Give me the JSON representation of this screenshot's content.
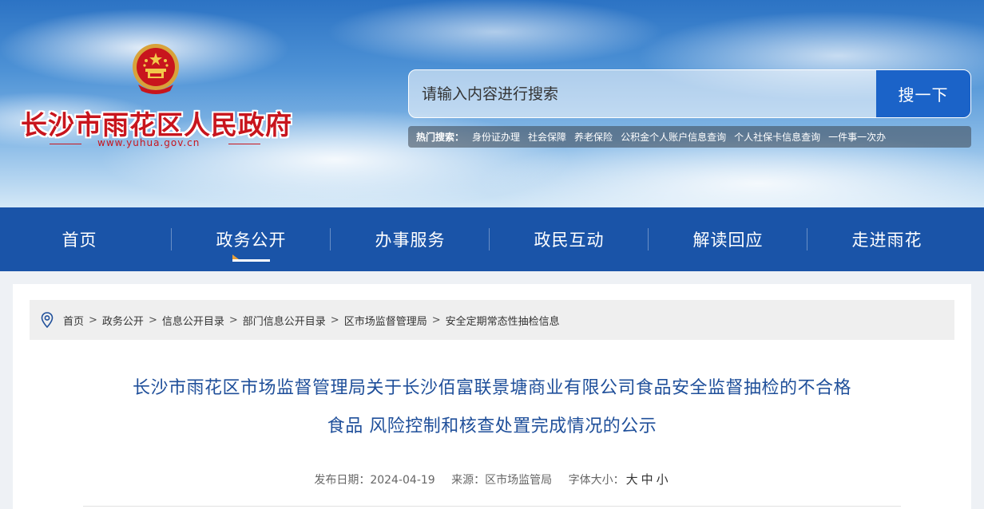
{
  "header": {
    "site_name": "长沙市雨花区人民政府",
    "site_domain": "www.yuhua.gov.cn",
    "emblem_icon": "national-emblem-icon",
    "brand_red": "#c8151d"
  },
  "search": {
    "placeholder": "请输入内容进行搜索",
    "button_label": "搜一下",
    "hot_label": "热门搜索：",
    "hot_links": [
      "身份证办理",
      "社会保障",
      "养老保险",
      "公积金个人账户信息查询",
      "个人社保卡信息查询",
      "一件事一次办"
    ]
  },
  "nav": {
    "bg_color": "#1a54a8",
    "items": [
      "首页",
      "政务公开",
      "办事服务",
      "政民互动",
      "解读回应",
      "走进雨花"
    ],
    "active_index": 1
  },
  "breadcrumb": {
    "icon": "location-pin-icon",
    "items": [
      "首页",
      "政务公开",
      "信息公开目录",
      "部门信息公开目录",
      "区市场监督管理局",
      "安全定期常态性抽检信息"
    ],
    "separator": ">"
  },
  "article": {
    "title_line1": "长沙市雨花区市场监督管理局关于长沙佰富联景塘商业有限公司食品安全监督抽检的不合格",
    "title_line2": "食品 风险控制和核查处置完成情况的公示",
    "publish_label": "发布日期：",
    "publish_date": "2024-04-19",
    "source_label": "来源：",
    "source": "区市场监管局",
    "font_size_label": "字体大小：",
    "font_sizes": [
      "大",
      "中",
      "小"
    ],
    "title_color": "#1f4f9a"
  }
}
